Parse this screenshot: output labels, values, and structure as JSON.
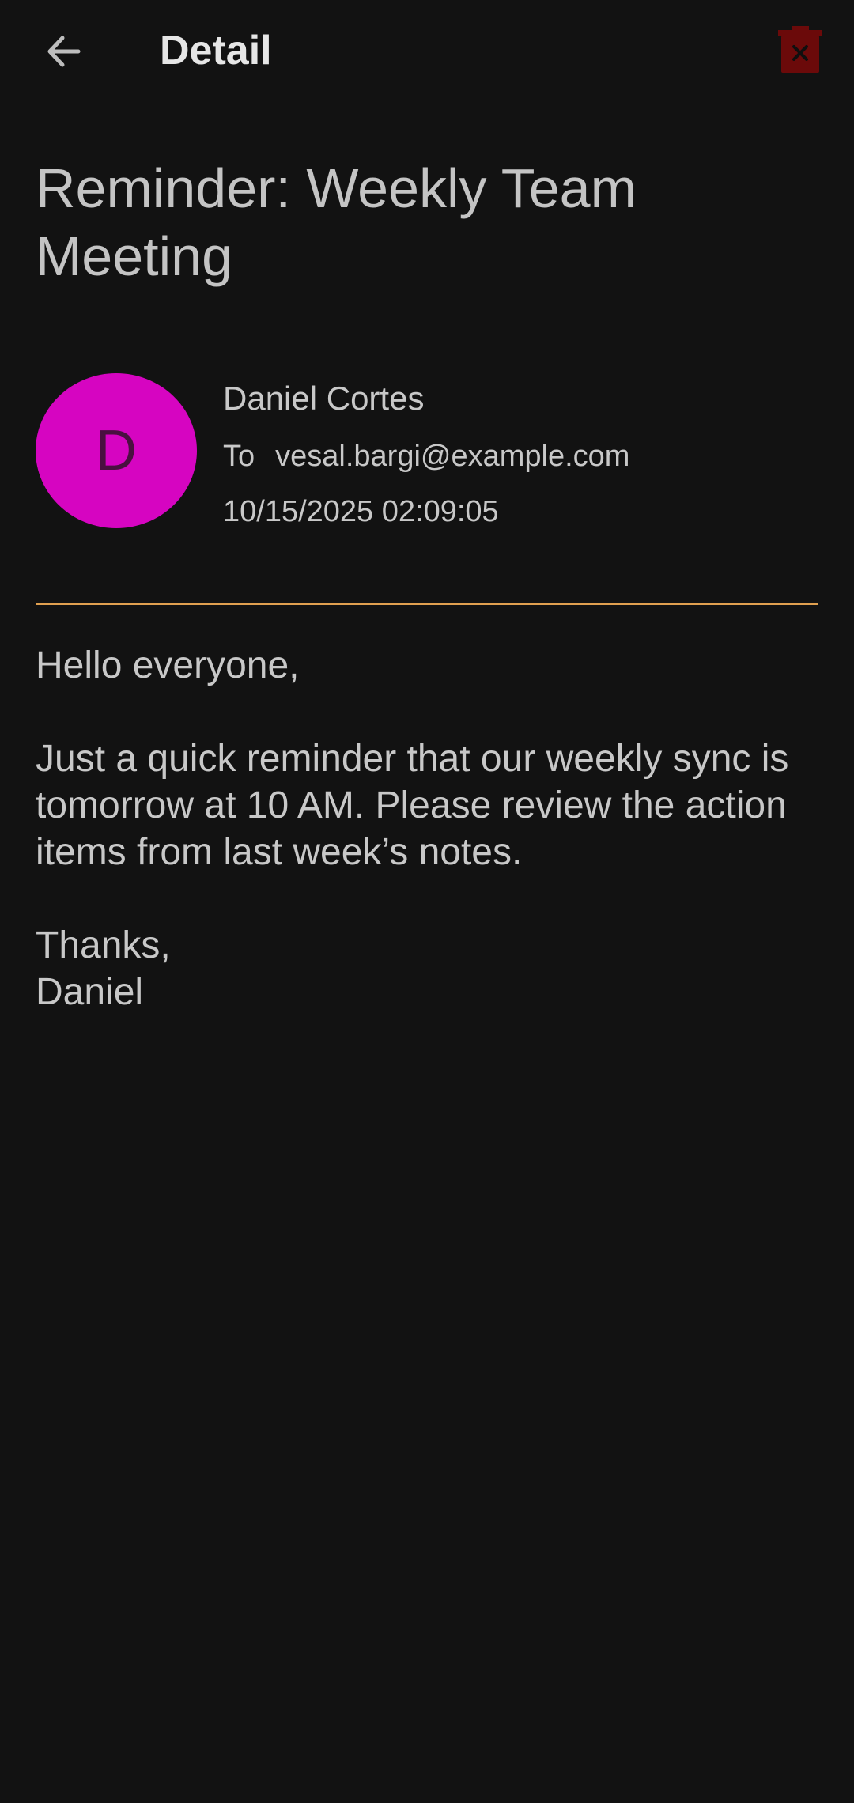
{
  "app_bar": {
    "title": "Detail",
    "back_icon": "arrow-left-icon",
    "delete_icon": "trash-icon"
  },
  "email": {
    "subject": "Reminder: Weekly Team Meeting",
    "avatar_letter": "D",
    "sender_name": "Daniel Cortes",
    "to_label": "To",
    "recipient": "vesal.bargi@example.com",
    "datetime": "10/15/2025 02:09:05",
    "body": {
      "greeting": "Hello everyone,",
      "paragraph": "Just a quick reminder that our weekly sync is tomorrow at 10 AM. Please review the action items from last week’s notes.",
      "closing": "Thanks,",
      "signature": "Daniel"
    }
  },
  "colors": {
    "background": "#121212",
    "avatar": "#d605c1",
    "divider": "#e0a050",
    "delete_icon": "#6b0a0a"
  }
}
